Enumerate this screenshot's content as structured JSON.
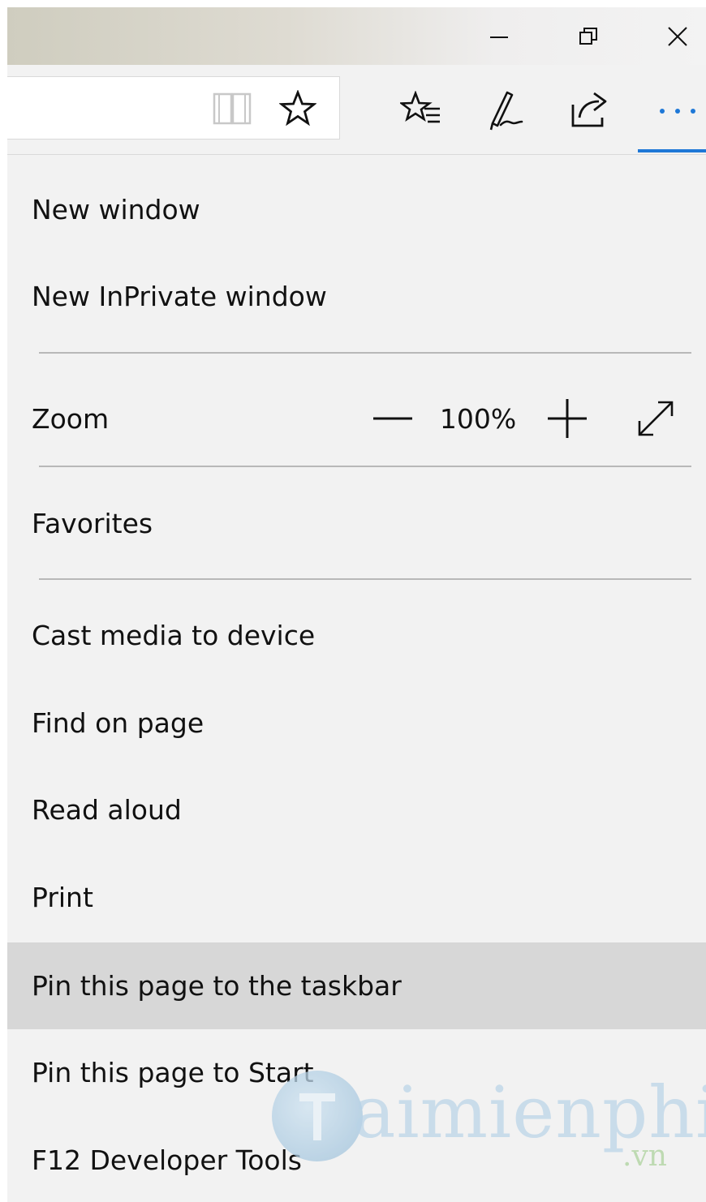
{
  "window_controls": {
    "minimize_icon": "minimize-icon",
    "restore_icon": "restore-icon",
    "close_icon": "close-icon"
  },
  "navbar": {
    "icons": [
      "reading-view-icon",
      "add-favorite-star-icon",
      "favorites-hub-icon",
      "web-note-pen-icon",
      "share-icon",
      "more-dots-icon"
    ],
    "accent_color": "#1e78d7"
  },
  "menu": {
    "items": [
      {
        "label": "New window"
      },
      {
        "label": "New InPrivate window"
      },
      {
        "label": "Favorites"
      },
      {
        "label": "Cast media to device"
      },
      {
        "label": "Find on page"
      },
      {
        "label": "Read aloud"
      },
      {
        "label": "Print"
      },
      {
        "label": "Pin this page to the taskbar",
        "highlighted": true
      },
      {
        "label": "Pin this page to Start"
      },
      {
        "label": "F12 Developer Tools"
      }
    ],
    "zoom": {
      "label": "Zoom",
      "value": "100%"
    }
  },
  "watermark": {
    "brand": "aimienphi",
    "suffix": ".vn"
  }
}
